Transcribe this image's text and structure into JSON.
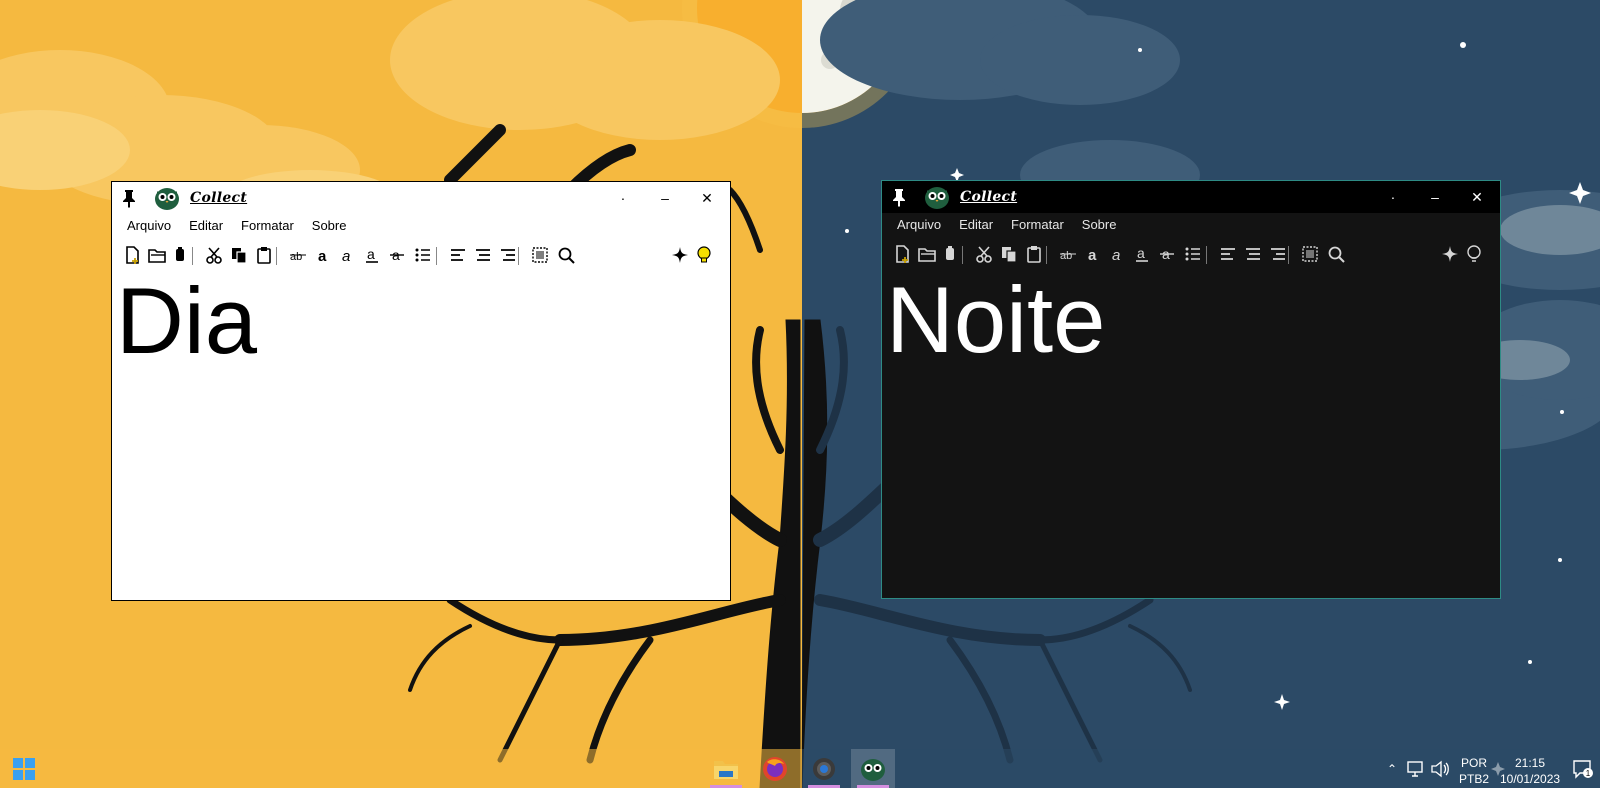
{
  "windows": [
    {
      "theme": "light",
      "app_title": "Collect",
      "menu": [
        "Arquivo",
        "Editar",
        "Formatar",
        "Sobre"
      ],
      "content": "Dia",
      "titlebar_buttons": {
        "dot": "·",
        "minimize": "–",
        "close": "✕"
      }
    },
    {
      "theme": "dark",
      "app_title": "Collect",
      "menu": [
        "Arquivo",
        "Editar",
        "Formatar",
        "Sobre"
      ],
      "content": "Noite",
      "titlebar_buttons": {
        "dot": "·",
        "minimize": "–",
        "close": "✕"
      }
    }
  ],
  "toolbar_icons": [
    "new-file-icon",
    "open-folder-icon",
    "save-icon",
    "cut-icon",
    "copy-icon",
    "paste-icon",
    "strikeover-ab-icon",
    "bold-icon",
    "italic-icon",
    "underline-icon",
    "strikethrough-icon",
    "bullet-list-icon",
    "align-left-icon",
    "align-center-icon",
    "align-right-icon",
    "select-all-icon",
    "search-icon",
    "sparkle-icon",
    "lightbulb-icon"
  ],
  "taskbar": {
    "apps": [
      "file-explorer-icon",
      "firefox-icon",
      "settings-icon",
      "collect-icon"
    ],
    "language": {
      "line1": "POR",
      "line2": "PTB2"
    },
    "clock": {
      "time": "21:15",
      "date": "10/01/2023"
    },
    "notification_count": "1"
  },
  "colors": {
    "day_sky": "#f5b940",
    "night_sky": "#2c4a66",
    "dark_window_border": "#2e8b85",
    "accent_bulb": "#f6e000"
  }
}
